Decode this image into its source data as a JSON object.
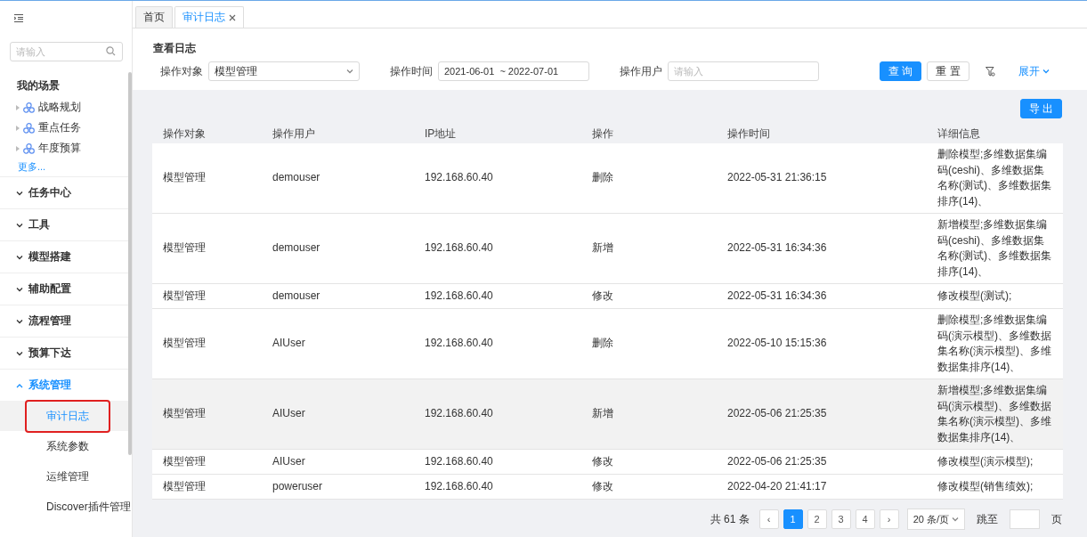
{
  "sidebar": {
    "search": {
      "placeholder": "请输入"
    },
    "scenes": {
      "title": "我的场景",
      "items": [
        {
          "label": "战略规划"
        },
        {
          "label": "重点任务"
        },
        {
          "label": "年度预算"
        }
      ],
      "more": "更多..."
    },
    "groups": [
      {
        "label": "任务中心",
        "expanded": false
      },
      {
        "label": "工具",
        "expanded": false
      },
      {
        "label": "模型搭建",
        "expanded": false
      },
      {
        "label": "辅助配置",
        "expanded": false
      },
      {
        "label": "流程管理",
        "expanded": false
      },
      {
        "label": "预算下达",
        "expanded": false
      },
      {
        "label": "系统管理",
        "expanded": true,
        "children": [
          {
            "label": "审计日志",
            "selected": true
          },
          {
            "label": "系统参数",
            "selected": false
          },
          {
            "label": "运维管理",
            "selected": false
          },
          {
            "label": "Discover插件管理",
            "selected": false
          }
        ]
      }
    ]
  },
  "tabs": [
    {
      "label": "首页",
      "selected": false,
      "closable": false
    },
    {
      "label": "审计日志",
      "selected": true,
      "closable": true
    }
  ],
  "filter": {
    "title": "查看日志",
    "object": {
      "label": "操作对象",
      "value": "模型管理"
    },
    "time": {
      "label": "操作时间",
      "value": "2021-06-01  ~ 2022-07-01"
    },
    "user": {
      "label": "操作用户",
      "placeholder": "请输入"
    },
    "query": "查 询",
    "reset": "重 置",
    "expand": "展开"
  },
  "export": "导 出",
  "table": {
    "columns": [
      "操作对象",
      "操作用户",
      "IP地址",
      "操作",
      "操作时间",
      "详细信息"
    ],
    "rows": [
      {
        "selected": false,
        "cells": [
          "模型管理",
          "demouser",
          "192.168.60.40",
          "删除",
          "2022-05-31 21:36:15",
          "删除模型;多维数据集编码(ceshi)、多维数据集名称(测试)、多维数据集排序(14)、"
        ]
      },
      {
        "selected": false,
        "cells": [
          "模型管理",
          "demouser",
          "192.168.60.40",
          "新增",
          "2022-05-31 16:34:36",
          "新增模型;多维数据集编码(ceshi)、多维数据集名称(测试)、多维数据集排序(14)、"
        ]
      },
      {
        "selected": false,
        "cells": [
          "模型管理",
          "demouser",
          "192.168.60.40",
          "修改",
          "2022-05-31 16:34:36",
          "修改模型(测试);"
        ]
      },
      {
        "selected": false,
        "cells": [
          "模型管理",
          "AIUser",
          "192.168.60.40",
          "删除",
          "2022-05-10 15:15:36",
          "删除模型;多维数据集编码(演示模型)、多维数据集名称(演示模型)、多维数据集排序(14)、"
        ]
      },
      {
        "selected": true,
        "cells": [
          "模型管理",
          "AIUser",
          "192.168.60.40",
          "新增",
          "2022-05-06 21:25:35",
          "新增模型;多维数据集编码(演示模型)、多维数据集名称(演示模型)、多维数据集排序(14)、"
        ]
      },
      {
        "selected": false,
        "cells": [
          "模型管理",
          "AIUser",
          "192.168.60.40",
          "修改",
          "2022-05-06 21:25:35",
          "修改模型(演示模型);"
        ]
      },
      {
        "selected": false,
        "cells": [
          "模型管理",
          "poweruser",
          "192.168.60.40",
          "修改",
          "2022-04-20 21:41:17",
          "修改模型(销售绩效);"
        ]
      }
    ]
  },
  "pagination": {
    "total": "共 61 条",
    "pages": [
      {
        "label": "1",
        "selected": true
      },
      {
        "label": "2",
        "selected": false
      },
      {
        "label": "3",
        "selected": false
      },
      {
        "label": "4",
        "selected": false
      }
    ],
    "prev": "‹",
    "next": "›",
    "page_size": "20 条/页",
    "jump_label": "跳至",
    "jump_suffix": "页"
  }
}
